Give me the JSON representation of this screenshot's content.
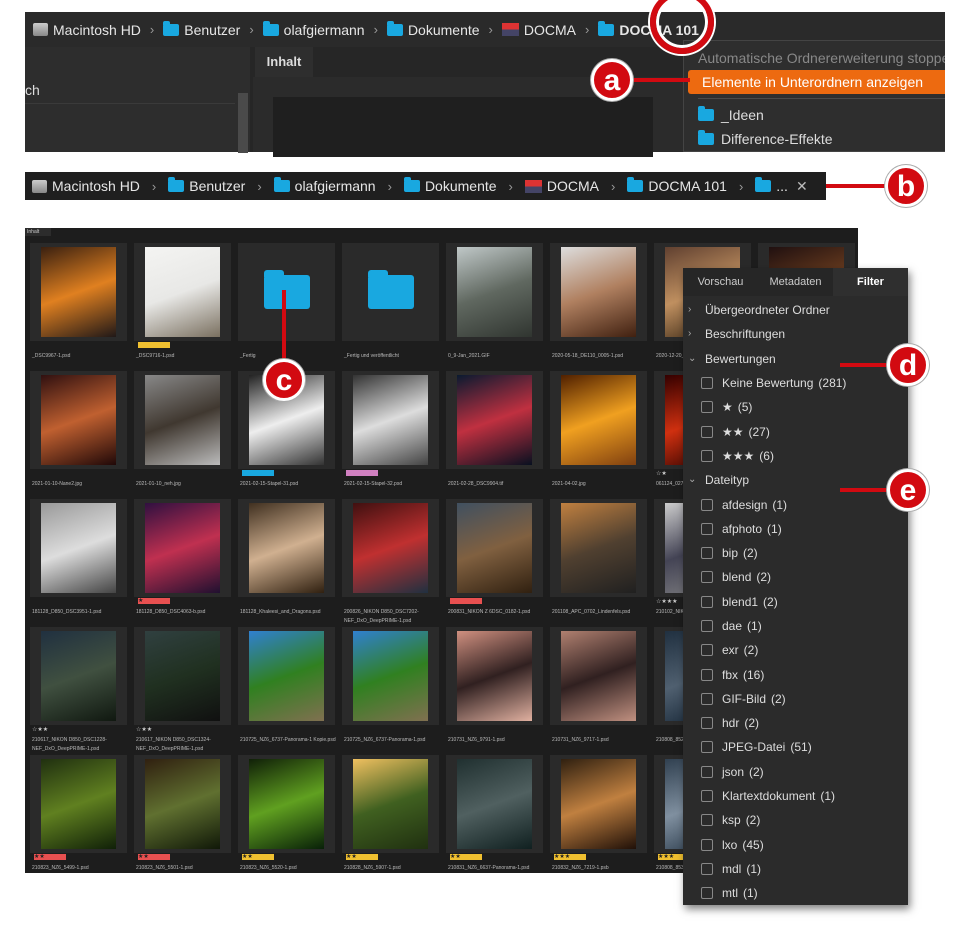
{
  "top_window": {
    "breadcrumb": [
      {
        "label": "Macintosh HD",
        "icon": "disk-icon"
      },
      {
        "label": "Benutzer",
        "icon": "folder-icon"
      },
      {
        "label": "olafgiermann",
        "icon": "folder-icon"
      },
      {
        "label": "Dokumente",
        "icon": "folder-icon"
      },
      {
        "label": "DOCMA",
        "icon": "docma-icon"
      },
      {
        "label": "DOCMA 101",
        "icon": "folder-icon"
      }
    ],
    "left_item": "ch",
    "tab": "Inhalt",
    "menu": {
      "disabled_item": "Automatische Ordnererweiterung stoppen",
      "active_item": "Elemente in Unterordnern anzeigen",
      "folders": [
        "_Ideen",
        "Difference-Effekte"
      ]
    }
  },
  "second_bar": {
    "breadcrumb": [
      "Macintosh HD",
      "Benutzer",
      "olafgiermann",
      "Dokumente",
      "DOCMA",
      "DOCMA 101",
      "..."
    ],
    "close": "✕"
  },
  "badges": {
    "a": "a",
    "b": "b",
    "c": "c",
    "d": "d",
    "e": "e"
  },
  "content": {
    "tab": "Inhalt",
    "thumbs": [
      {
        "name": "_DSC9967-1.psd",
        "g": [
          "#3a2010",
          "#e08020",
          "#201818"
        ]
      },
      {
        "name": "_DSC9716-1.psd",
        "label": "#f0c030",
        "g": [
          "#f4f4f2",
          "#e8e8e6",
          "#7a7060"
        ]
      },
      {
        "name": "_Fertig",
        "folder": true
      },
      {
        "name": "_Fertig und veröffentlicht",
        "folder": true
      },
      {
        "name": "0_9-Jan_2021.GIF",
        "g": [
          "#c0c8c8",
          "#606860",
          "#303530"
        ]
      },
      {
        "name": "2020-05-18_DE110_0005-1.psd",
        "g": [
          "#ddd",
          "#b08060",
          "#402010"
        ]
      },
      {
        "name": "2020-12-20_ ... ruhe1.jpg",
        "g": [
          "#604030",
          "#c09060",
          "#302010"
        ]
      },
      {
        "name": "",
        "g": [
          "#201010",
          "#704020",
          "#100808"
        ]
      },
      {
        "name": "2021-01-10-Nane2.jpg",
        "g": [
          "#301010",
          "#c06030",
          "#200808"
        ]
      },
      {
        "name": "2021-01-10_neh.jpg",
        "g": [
          "#888",
          "#403830",
          "#bbb"
        ]
      },
      {
        "name": "2021-02-15-Stapel-31.psd",
        "label": "#19a8e0",
        "g": [
          "#222",
          "#eee",
          "#333"
        ]
      },
      {
        "name": "2021-02-15-Stapel-32.psd",
        "label": "#d080c0",
        "g": [
          "#333",
          "#ddd",
          "#444"
        ]
      },
      {
        "name": "2021-02-28_DSC9904.tif",
        "g": [
          "#0a1a30",
          "#c03040",
          "#081020"
        ]
      },
      {
        "name": "2021-04-02.jpg",
        "g": [
          "#502000",
          "#f0a020",
          "#804010"
        ]
      },
      {
        "name": "061124_0273...",
        "stars": "☆★",
        "g": [
          "#300",
          "#d03010",
          "#200"
        ]
      },
      {
        "name": "",
        "g": [
          "#222",
          "#444",
          "#222"
        ]
      },
      {
        "name": "181128_D850_DSC3951-1.psd",
        "g": [
          "#999",
          "#ddd",
          "#444"
        ]
      },
      {
        "name": "181128_D850_DSC4063-b.psd",
        "label": "#e85050",
        "labelText": "★",
        "g": [
          "#301040",
          "#c03050",
          "#201030"
        ]
      },
      {
        "name": "181128_Khaleesi_and_Dragons.psd",
        "g": [
          "#403020",
          "#d0b090",
          "#302010"
        ]
      },
      {
        "name": "200826_NIKON D850_DSC7202-NEF_DxO_DeepPRIME-1.psd",
        "g": [
          "#401010",
          "#c03030",
          "#203040"
        ]
      },
      {
        "name": "200831_NIKON Z 6DSC_0182-1.psd",
        "label": "#e85050",
        "g": [
          "#405060",
          "#806040",
          "#302010"
        ]
      },
      {
        "name": "201108_APC_0702_Lindenfels.psd",
        "g": [
          "#c08040",
          "#504030",
          "#202020"
        ]
      },
      {
        "name": "210102_NIKO...",
        "stars": "☆★★★",
        "g": [
          "#ccc",
          "#445",
          "#888"
        ]
      },
      {
        "name": "",
        "g": [
          "#222",
          "#333",
          "#222"
        ]
      },
      {
        "name": "210617_NIKON D850_DSC1228-NEF_DxO_DeepPRIME-1.psd",
        "stars": "☆★★",
        "g": [
          "#203040",
          "#405040",
          "#101810"
        ]
      },
      {
        "name": "210617_NIKON D850_DSC1324-NEF_DxO_DeepPRIME-1.psd",
        "stars": "☆★★",
        "g": [
          "#304040",
          "#203020",
          "#101010"
        ]
      },
      {
        "name": "210725_NZ6_6737-Panorama-1 Kopie.psd",
        "g": [
          "#3080d0",
          "#308020",
          "#807050"
        ]
      },
      {
        "name": "210725_NZ6_6737-Panorama-1.psd",
        "g": [
          "#3080d0",
          "#308020",
          "#807050"
        ]
      },
      {
        "name": "210731_NZ6_9791-1.psd",
        "g": [
          "#d09080",
          "#302020",
          "#e0b0a0"
        ]
      },
      {
        "name": "210731_NZ6_9717-1.psd",
        "g": [
          "#b08070",
          "#302020",
          "#c09080"
        ]
      },
      {
        "name": "210808_852...",
        "g": [
          "#203040",
          "#506070",
          "#102030"
        ]
      },
      {
        "name": "",
        "g": [
          "#222",
          "#333",
          "#222"
        ]
      },
      {
        "name": "210823_NZ6_5499-1.psd",
        "label": "#e85050",
        "labelText": "★★",
        "g": [
          "#203010",
          "#608020",
          "#102008"
        ]
      },
      {
        "name": "210823_NZ6_5501-1.psd",
        "label": "#e85050",
        "labelText": "★★",
        "g": [
          "#302010",
          "#607030",
          "#101808"
        ]
      },
      {
        "name": "210823_NZ6_5520-1.psd",
        "label": "#f0c030",
        "labelText": "★★",
        "g": [
          "#102008",
          "#60a020",
          "#082008"
        ]
      },
      {
        "name": "210828_NZ6_5907-1.psd",
        "label": "#f0c030",
        "labelText": "★★",
        "g": [
          "#f0c060",
          "#406020",
          "#203010"
        ]
      },
      {
        "name": "210831_NZ6_6637-Panorama-1.psd",
        "label": "#f0c030",
        "labelText": "★★",
        "g": [
          "#203030",
          "#506060",
          "#102020"
        ]
      },
      {
        "name": "210832_NZ6_7219-1.psb",
        "label": "#f0c030",
        "labelText": "★★★",
        "g": [
          "#302010",
          "#c08040",
          "#201008"
        ]
      },
      {
        "name": "210808_853...",
        "label": "#f0c030",
        "labelText": "★★★",
        "g": [
          "#304050",
          "#8090a0",
          "#203040"
        ]
      },
      {
        "name": "",
        "g": [
          "#222",
          "#333",
          "#222"
        ]
      }
    ]
  },
  "filter_panel": {
    "tabs": [
      "Vorschau",
      "Metadaten",
      "Filter"
    ],
    "rows": [
      {
        "type": "section",
        "label": "Übergeordneter Ordner",
        "open": false
      },
      {
        "type": "section",
        "label": "Beschriftungen",
        "open": false
      },
      {
        "type": "section",
        "label": "Bewertungen",
        "open": true
      },
      {
        "type": "check",
        "label": "Keine Bewertung",
        "count": "(281)"
      },
      {
        "type": "check",
        "label": "★",
        "count": "(5)"
      },
      {
        "type": "check",
        "label": "★★",
        "count": "(27)"
      },
      {
        "type": "check",
        "label": "★★★",
        "count": "(6)"
      },
      {
        "type": "section",
        "label": "Dateityp",
        "open": true
      },
      {
        "type": "check",
        "label": "afdesign",
        "count": "(1)"
      },
      {
        "type": "check",
        "label": "afphoto",
        "count": "(1)"
      },
      {
        "type": "check",
        "label": "bip",
        "count": "(2)"
      },
      {
        "type": "check",
        "label": "blend",
        "count": "(2)"
      },
      {
        "type": "check",
        "label": "blend1",
        "count": "(2)"
      },
      {
        "type": "check",
        "label": "dae",
        "count": "(1)"
      },
      {
        "type": "check",
        "label": "exr",
        "count": "(2)"
      },
      {
        "type": "check",
        "label": "fbx",
        "count": "(16)"
      },
      {
        "type": "check",
        "label": "GIF-Bild",
        "count": "(2)"
      },
      {
        "type": "check",
        "label": "hdr",
        "count": "(2)"
      },
      {
        "type": "check",
        "label": "JPEG-Datei",
        "count": "(51)"
      },
      {
        "type": "check",
        "label": "json",
        "count": "(2)"
      },
      {
        "type": "check",
        "label": "Klartextdokument",
        "count": "(1)"
      },
      {
        "type": "check",
        "label": "ksp",
        "count": "(2)"
      },
      {
        "type": "check",
        "label": "lxo",
        "count": "(45)"
      },
      {
        "type": "check",
        "label": "mdl",
        "count": "(1)"
      },
      {
        "type": "check",
        "label": "mtl",
        "count": "(1)"
      }
    ]
  }
}
